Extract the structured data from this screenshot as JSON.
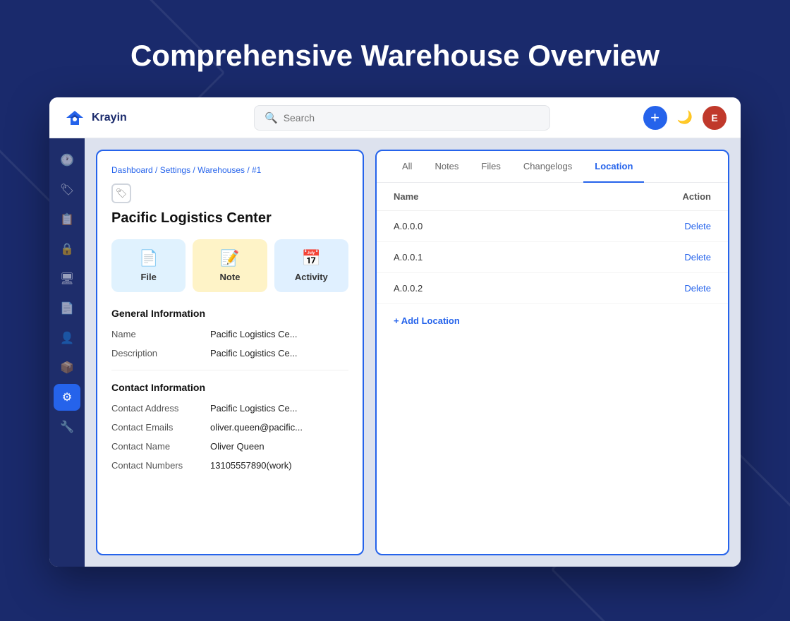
{
  "page": {
    "title": "Comprehensive Warehouse Overview"
  },
  "topbar": {
    "logo_text": "Krayin",
    "search_placeholder": "Search",
    "add_btn_label": "+",
    "avatar_label": "E"
  },
  "sidebar": {
    "items": [
      {
        "id": "clock",
        "icon": "🕐",
        "active": false
      },
      {
        "id": "tag",
        "icon": "🏷",
        "active": false
      },
      {
        "id": "file",
        "icon": "📋",
        "active": false
      },
      {
        "id": "lock",
        "icon": "🔒",
        "active": false
      },
      {
        "id": "monitor",
        "icon": "🖥",
        "active": false
      },
      {
        "id": "list",
        "icon": "📄",
        "active": false
      },
      {
        "id": "person",
        "icon": "👤",
        "active": false
      },
      {
        "id": "box",
        "icon": "📦",
        "active": false
      },
      {
        "id": "settings",
        "icon": "⚙",
        "active": true
      },
      {
        "id": "wrench",
        "icon": "🔧",
        "active": false
      }
    ]
  },
  "left_panel": {
    "breadcrumb": "Dashboard / Settings / Warehouses / #1",
    "entity_title": "Pacific Logistics Center",
    "actions": [
      {
        "id": "file",
        "label": "File",
        "icon": "📄"
      },
      {
        "id": "note",
        "label": "Note",
        "icon": "📝"
      },
      {
        "id": "activity",
        "label": "Activity",
        "icon": "📅"
      }
    ],
    "general_info": {
      "title": "General Information",
      "fields": [
        {
          "label": "Name",
          "value": "Pacific Logistics Ce..."
        },
        {
          "label": "Description",
          "value": "Pacific Logistics Ce..."
        }
      ]
    },
    "contact_info": {
      "title": "Contact Information",
      "fields": [
        {
          "label": "Contact Address",
          "value": "Pacific Logistics Ce..."
        },
        {
          "label": "Contact Emails",
          "value": "oliver.queen@pacific..."
        },
        {
          "label": "Contact Name",
          "value": "Oliver Queen"
        },
        {
          "label": "Contact Numbers",
          "value": "13105557890(work)"
        }
      ]
    }
  },
  "right_panel": {
    "tabs": [
      {
        "id": "all",
        "label": "All",
        "active": false
      },
      {
        "id": "notes",
        "label": "Notes",
        "active": false
      },
      {
        "id": "files",
        "label": "Files",
        "active": false
      },
      {
        "id": "changelogs",
        "label": "Changelogs",
        "active": false
      },
      {
        "id": "location",
        "label": "Location",
        "active": true
      }
    ],
    "table": {
      "columns": [
        {
          "id": "name",
          "label": "Name"
        },
        {
          "id": "action",
          "label": "Action"
        }
      ],
      "rows": [
        {
          "name": "A.0.0.0",
          "action": "Delete"
        },
        {
          "name": "A.0.0.1",
          "action": "Delete"
        },
        {
          "name": "A.0.0.2",
          "action": "Delete"
        }
      ],
      "add_label": "+ Add Location"
    }
  },
  "colors": {
    "primary": "#2563eb",
    "bg_dark": "#1a2a6c",
    "sidebar_bg": "#1e2d6b"
  }
}
